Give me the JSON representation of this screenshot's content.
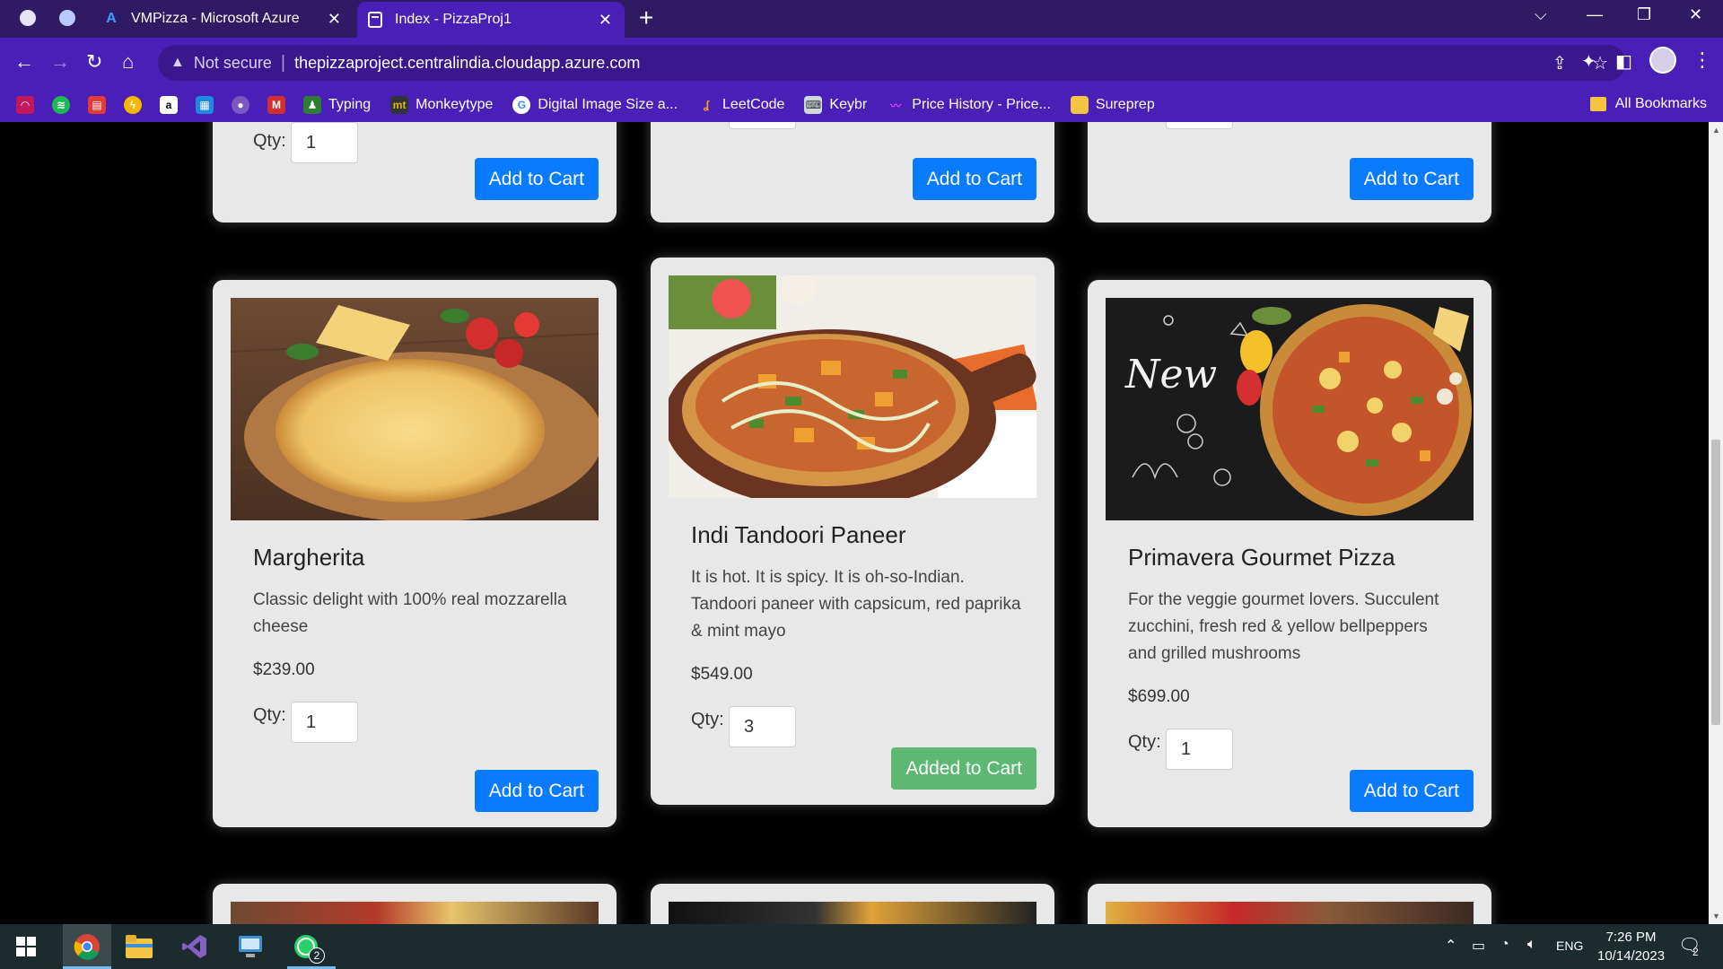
{
  "browser": {
    "tabs": [
      {
        "title": "VMPizza - Microsoft Azure",
        "active": false
      },
      {
        "title": "Index - PizzaProj1",
        "active": true
      }
    ],
    "address": {
      "security_label": "Not secure",
      "url": "thepizzaproject.centralindia.cloudapp.azure.com"
    },
    "bookmarks": [
      {
        "label": "Typing"
      },
      {
        "label": "Monkeytype"
      },
      {
        "label": "Digital Image Size a..."
      },
      {
        "label": "LeetCode"
      },
      {
        "label": "Keybr"
      },
      {
        "label": "Price History - Price..."
      },
      {
        "label": "Sureprep"
      }
    ],
    "all_bookmarks_label": "All Bookmarks"
  },
  "page": {
    "top_row": [
      {
        "qty_label": "Qty:",
        "qty": "1",
        "button": "Add to Cart"
      },
      {
        "button": "Add to Cart"
      },
      {
        "button": "Add to Cart"
      }
    ],
    "products": [
      {
        "name": "Margherita",
        "description": "Classic delight with 100% real mozzarella cheese",
        "price": "$239.00",
        "qty_label": "Qty:",
        "qty": "1",
        "button": "Add to Cart"
      },
      {
        "name": "Indi Tandoori Paneer",
        "description": "It is hot. It is spicy. It is oh-so-Indian. Tandoori paneer with capsicum, red paprika & mint mayo",
        "price": "$549.00",
        "qty_label": "Qty:",
        "qty": "3",
        "button": "Added to Cart"
      },
      {
        "name": "Primavera Gourmet Pizza",
        "description": "For the veggie gourmet lovers. Succulent zucchini, fresh red & yellow bellpeppers and grilled mushrooms",
        "price": "$699.00",
        "qty_label": "Qty:",
        "qty": "1",
        "button": "Add to Cart",
        "image_text": "New"
      }
    ]
  },
  "taskbar": {
    "whatsapp_badge": "2",
    "language": "ENG",
    "time": "7:26 PM",
    "date": "10/14/2023",
    "notifications": "2"
  },
  "colors": {
    "tab_bar": "#2f1a63",
    "toolbar": "#4a1fb8",
    "card_bg": "#e8e8e8",
    "add_button": "#0a7bff",
    "added_button": "#5cb873",
    "taskbar": "#1c2b2e"
  }
}
